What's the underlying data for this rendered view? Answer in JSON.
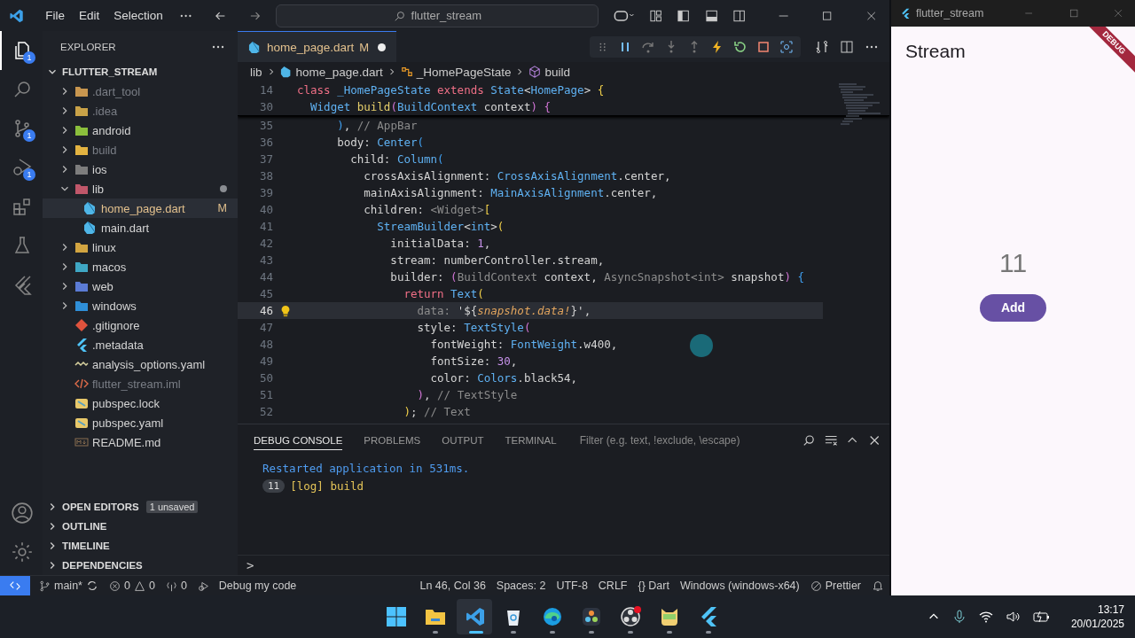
{
  "title_bar": {
    "menu": [
      "File",
      "Edit",
      "Selection"
    ],
    "search": "flutter_stream"
  },
  "activity_bar": {
    "items": [
      {
        "kind": "explorer",
        "selected": true,
        "badge": "1"
      },
      {
        "kind": "search",
        "selected": false
      },
      {
        "kind": "source-control",
        "selected": false,
        "badge": "1"
      },
      {
        "kind": "run-debug",
        "selected": false,
        "badge": "1"
      },
      {
        "kind": "extensions",
        "selected": false
      },
      {
        "kind": "testing",
        "selected": false
      },
      {
        "kind": "flutter",
        "selected": false
      }
    ],
    "bottom": [
      {
        "kind": "accounts"
      },
      {
        "kind": "settings"
      }
    ]
  },
  "sidebar": {
    "title": "EXPLORER",
    "root": {
      "label": "FLUTTER_STREAM",
      "expanded": true
    },
    "tree": [
      {
        "label": ".dart_tool",
        "kind": "folder",
        "color": "#c8964f",
        "expanded": false,
        "selected": false,
        "dimmed": true
      },
      {
        "label": ".idea",
        "kind": "folder",
        "color": "#c9a248",
        "expanded": false,
        "selected": false,
        "dimmed": true
      },
      {
        "label": "android",
        "kind": "folder",
        "color": "#8bbf3c",
        "expanded": false,
        "selected": false,
        "dimmed": false
      },
      {
        "label": "build",
        "kind": "folder",
        "color": "#e3b341",
        "expanded": false,
        "selected": false,
        "dimmed": true
      },
      {
        "label": "ios",
        "kind": "folder",
        "color": "#7d7d7d",
        "expanded": false,
        "selected": false,
        "dimmed": false
      },
      {
        "label": "lib",
        "kind": "folder",
        "color": "#c0576a",
        "expanded": true,
        "selected": false,
        "dimmed": false,
        "contains_changes": true,
        "children": [
          {
            "label": "home_page.dart",
            "kind": "dart",
            "selected": true,
            "dimmed": false,
            "badge": "M"
          },
          {
            "label": "main.dart",
            "kind": "dart",
            "selected": false,
            "dimmed": false
          }
        ]
      },
      {
        "label": "linux",
        "kind": "folder",
        "color": "#d2a541",
        "expanded": false,
        "selected": false,
        "dimmed": false
      },
      {
        "label": "macos",
        "kind": "folder",
        "color": "#3fa7c4",
        "expanded": false,
        "selected": false,
        "dimmed": false
      },
      {
        "label": "web",
        "kind": "folder",
        "color": "#5b7bd5",
        "expanded": false,
        "selected": false,
        "dimmed": false
      },
      {
        "label": "windows",
        "kind": "folder",
        "color": "#2f8fd8",
        "expanded": false,
        "selected": false,
        "dimmed": false
      },
      {
        "label": ".gitignore",
        "kind": "git",
        "selected": false,
        "dimmed": false
      },
      {
        "label": ".metadata",
        "kind": "flutter",
        "selected": false,
        "dimmed": false
      },
      {
        "label": "analysis_options.yaml",
        "kind": "yaml",
        "selected": false,
        "dimmed": false
      },
      {
        "label": "flutter_stream.iml",
        "kind": "xml",
        "selected": false,
        "dimmed": true
      },
      {
        "label": "pubspec.lock",
        "kind": "lock",
        "selected": false,
        "dimmed": false
      },
      {
        "label": "pubspec.yaml",
        "kind": "lock",
        "selected": false,
        "dimmed": false
      },
      {
        "label": "README.md",
        "kind": "md",
        "selected": false,
        "dimmed": false
      }
    ],
    "sections": [
      {
        "label": "OPEN EDITORS",
        "expanded": false,
        "badge": "1 unsaved"
      },
      {
        "label": "OUTLINE",
        "expanded": false
      },
      {
        "label": "TIMELINE",
        "expanded": false
      },
      {
        "label": "DEPENDENCIES",
        "expanded": false
      }
    ]
  },
  "editor": {
    "tabs": [
      {
        "label": "home_page.dart",
        "status": "M",
        "unsaved": true,
        "selected": true
      }
    ],
    "breadcrumbs": [
      {
        "label": "lib",
        "kind": "folder"
      },
      {
        "label": "home_page.dart",
        "kind": "dart"
      },
      {
        "label": "_HomePageState",
        "kind": "class"
      },
      {
        "label": "build",
        "kind": "method"
      }
    ],
    "sticky_lines": [
      {
        "number": "14",
        "tokens": [
          {
            "kind": "kw",
            "text": "class "
          },
          {
            "kind": "type",
            "text": "_HomePageState "
          },
          {
            "kind": "kw",
            "text": "extends "
          },
          {
            "kind": "type",
            "text": "State"
          },
          {
            "kind": "plain",
            "text": "<"
          },
          {
            "kind": "type",
            "text": "HomePage"
          },
          {
            "kind": "plain",
            "text": "> "
          },
          {
            "kind": "br1",
            "text": "{"
          }
        ]
      },
      {
        "number": "30",
        "tokens": [
          {
            "kind": "type",
            "text": "  Widget "
          },
          {
            "kind": "fn",
            "text": "build"
          },
          {
            "kind": "br2",
            "text": "("
          },
          {
            "kind": "type",
            "text": "BuildContext "
          },
          {
            "kind": "plain",
            "text": "context"
          },
          {
            "kind": "br2",
            "text": ")"
          },
          {
            "kind": "br2",
            "text": " {"
          }
        ]
      }
    ],
    "lines": [
      {
        "number": "35",
        "current": false,
        "tokens": [
          {
            "kind": "br3",
            "text": "      )"
          },
          {
            "kind": "plain",
            "text": ", "
          },
          {
            "kind": "comment",
            "text": "// AppBar"
          }
        ]
      },
      {
        "number": "36",
        "current": false,
        "tokens": [
          {
            "kind": "plain",
            "text": "      body: "
          },
          {
            "kind": "type",
            "text": "Center"
          },
          {
            "kind": "br3",
            "text": "("
          }
        ]
      },
      {
        "number": "37",
        "current": false,
        "tokens": [
          {
            "kind": "plain",
            "text": "        child: "
          },
          {
            "kind": "type",
            "text": "Column"
          },
          {
            "kind": "br3",
            "text": "("
          }
        ]
      },
      {
        "number": "38",
        "current": false,
        "tokens": [
          {
            "kind": "plain",
            "text": "          crossAxisAlignment: "
          },
          {
            "kind": "type",
            "text": "CrossAxisAlignment"
          },
          {
            "kind": "plain",
            "text": ".center,"
          }
        ]
      },
      {
        "number": "39",
        "current": false,
        "tokens": [
          {
            "kind": "plain",
            "text": "          mainAxisAlignment: "
          },
          {
            "kind": "type",
            "text": "MainAxisAlignment"
          },
          {
            "kind": "plain",
            "text": ".center,"
          }
        ]
      },
      {
        "number": "40",
        "current": false,
        "tokens": [
          {
            "kind": "plain",
            "text": "          children: "
          },
          {
            "kind": "hint",
            "text": "<Widget>"
          },
          {
            "kind": "br1",
            "text": "["
          }
        ]
      },
      {
        "number": "41",
        "current": false,
        "tokens": [
          {
            "kind": "type",
            "text": "            StreamBuilder"
          },
          {
            "kind": "plain",
            "text": "<"
          },
          {
            "kind": "type",
            "text": "int"
          },
          {
            "kind": "plain",
            "text": ">"
          },
          {
            "kind": "br1",
            "text": "("
          }
        ]
      },
      {
        "number": "42",
        "current": false,
        "tokens": [
          {
            "kind": "plain",
            "text": "              initialData: "
          },
          {
            "kind": "num",
            "text": "1"
          },
          {
            "kind": "plain",
            "text": ","
          }
        ]
      },
      {
        "number": "43",
        "current": false,
        "tokens": [
          {
            "kind": "plain",
            "text": "              stream: numberController.stream,"
          }
        ]
      },
      {
        "number": "44",
        "current": false,
        "tokens": [
          {
            "kind": "plain",
            "text": "              builder: "
          },
          {
            "kind": "br2",
            "text": "("
          },
          {
            "kind": "hint",
            "text": "BuildContext "
          },
          {
            "kind": "plain",
            "text": "context, "
          },
          {
            "kind": "hint",
            "text": "AsyncSnapshot<int> "
          },
          {
            "kind": "plain",
            "text": "snapshot"
          },
          {
            "kind": "br2",
            "text": ")"
          },
          {
            "kind": "br3",
            "text": " {"
          }
        ]
      },
      {
        "number": "45",
        "current": false,
        "tokens": [
          {
            "kind": "kw",
            "text": "                return "
          },
          {
            "kind": "type",
            "text": "Text"
          },
          {
            "kind": "br1",
            "text": "("
          }
        ]
      },
      {
        "number": "46",
        "current": true,
        "tokens": [
          {
            "kind": "hint",
            "text": "                  data: "
          },
          {
            "kind": "str",
            "text": "'${"
          },
          {
            "kind": "interp",
            "text": "snapshot.data!"
          },
          {
            "kind": "str",
            "text": "}'"
          },
          {
            "kind": "plain",
            "text": ","
          }
        ]
      },
      {
        "number": "47",
        "current": false,
        "tokens": [
          {
            "kind": "plain",
            "text": "                  style: "
          },
          {
            "kind": "type",
            "text": "TextStyle"
          },
          {
            "kind": "br2",
            "text": "("
          }
        ]
      },
      {
        "number": "48",
        "current": false,
        "tokens": [
          {
            "kind": "plain",
            "text": "                    fontWeight: "
          },
          {
            "kind": "type",
            "text": "FontWeight"
          },
          {
            "kind": "plain",
            "text": ".w400,"
          }
        ]
      },
      {
        "number": "49",
        "current": false,
        "tokens": [
          {
            "kind": "plain",
            "text": "                    fontSize: "
          },
          {
            "kind": "num",
            "text": "30"
          },
          {
            "kind": "plain",
            "text": ","
          }
        ]
      },
      {
        "number": "50",
        "current": false,
        "tokens": [
          {
            "kind": "plain",
            "text": "                    color: "
          },
          {
            "kind": "type",
            "text": "Colors"
          },
          {
            "kind": "plain",
            "text": ".black54,"
          }
        ]
      },
      {
        "number": "51",
        "current": false,
        "tokens": [
          {
            "kind": "br2",
            "text": "                  )"
          },
          {
            "kind": "plain",
            "text": ", "
          },
          {
            "kind": "comment",
            "text": "// TextStyle"
          }
        ]
      },
      {
        "number": "52",
        "current": false,
        "tokens": [
          {
            "kind": "br1",
            "text": "                )"
          },
          {
            "kind": "plain",
            "text": "; "
          },
          {
            "kind": "comment",
            "text": "// Text"
          }
        ]
      }
    ]
  },
  "panel": {
    "tabs": [
      {
        "label": "DEBUG CONSOLE",
        "selected": true
      },
      {
        "label": "PROBLEMS",
        "selected": false
      },
      {
        "label": "OUTPUT",
        "selected": false
      },
      {
        "label": "TERMINAL",
        "selected": false
      }
    ],
    "filter": {
      "placeholder": "Filter (e.g. text, !exclude, \\escape)"
    },
    "console": [
      {
        "kind": "info",
        "text": "Restarted application in 531ms."
      },
      {
        "kind": "log",
        "count": "11",
        "text": "[log] build"
      }
    ],
    "prompt": ">"
  },
  "status_bar": {
    "left": [
      {
        "kind": "branch",
        "text": "main*"
      },
      {
        "kind": "problems",
        "errors": "0",
        "warnings": "0"
      },
      {
        "kind": "ports",
        "text": "0"
      },
      {
        "kind": "debug",
        "text": "Debug my code"
      }
    ],
    "right": [
      {
        "kind": "plain",
        "text": "Ln 46, Col 36"
      },
      {
        "kind": "plain",
        "text": "Spaces: 2"
      },
      {
        "kind": "plain",
        "text": "UTF-8"
      },
      {
        "kind": "plain",
        "text": "CRLF"
      },
      {
        "kind": "plain",
        "text": "{}  Dart"
      },
      {
        "kind": "plain",
        "text": "Windows (windows-x64)"
      },
      {
        "kind": "prettier",
        "text": "Prettier"
      },
      {
        "kind": "bell"
      }
    ]
  },
  "app_window": {
    "title": "flutter_stream",
    "app_bar": "Stream",
    "banner": "DEBUG",
    "counter": "11",
    "button": "Add"
  },
  "taskbar": {
    "apps": [
      {
        "kind": "start",
        "active": false
      },
      {
        "kind": "files",
        "active": false,
        "running": true
      },
      {
        "kind": "vscode",
        "active": true,
        "running": true
      },
      {
        "kind": "recycle",
        "active": false,
        "running": true
      },
      {
        "kind": "edge",
        "active": false,
        "running": true
      },
      {
        "kind": "resolve",
        "active": false,
        "running": true
      },
      {
        "kind": "obs",
        "active": false,
        "running": true
      },
      {
        "kind": "cat",
        "active": false,
        "running": true
      },
      {
        "kind": "flutter",
        "active": false,
        "running": true
      }
    ],
    "time": "13:17",
    "date": "20/01/2025"
  }
}
